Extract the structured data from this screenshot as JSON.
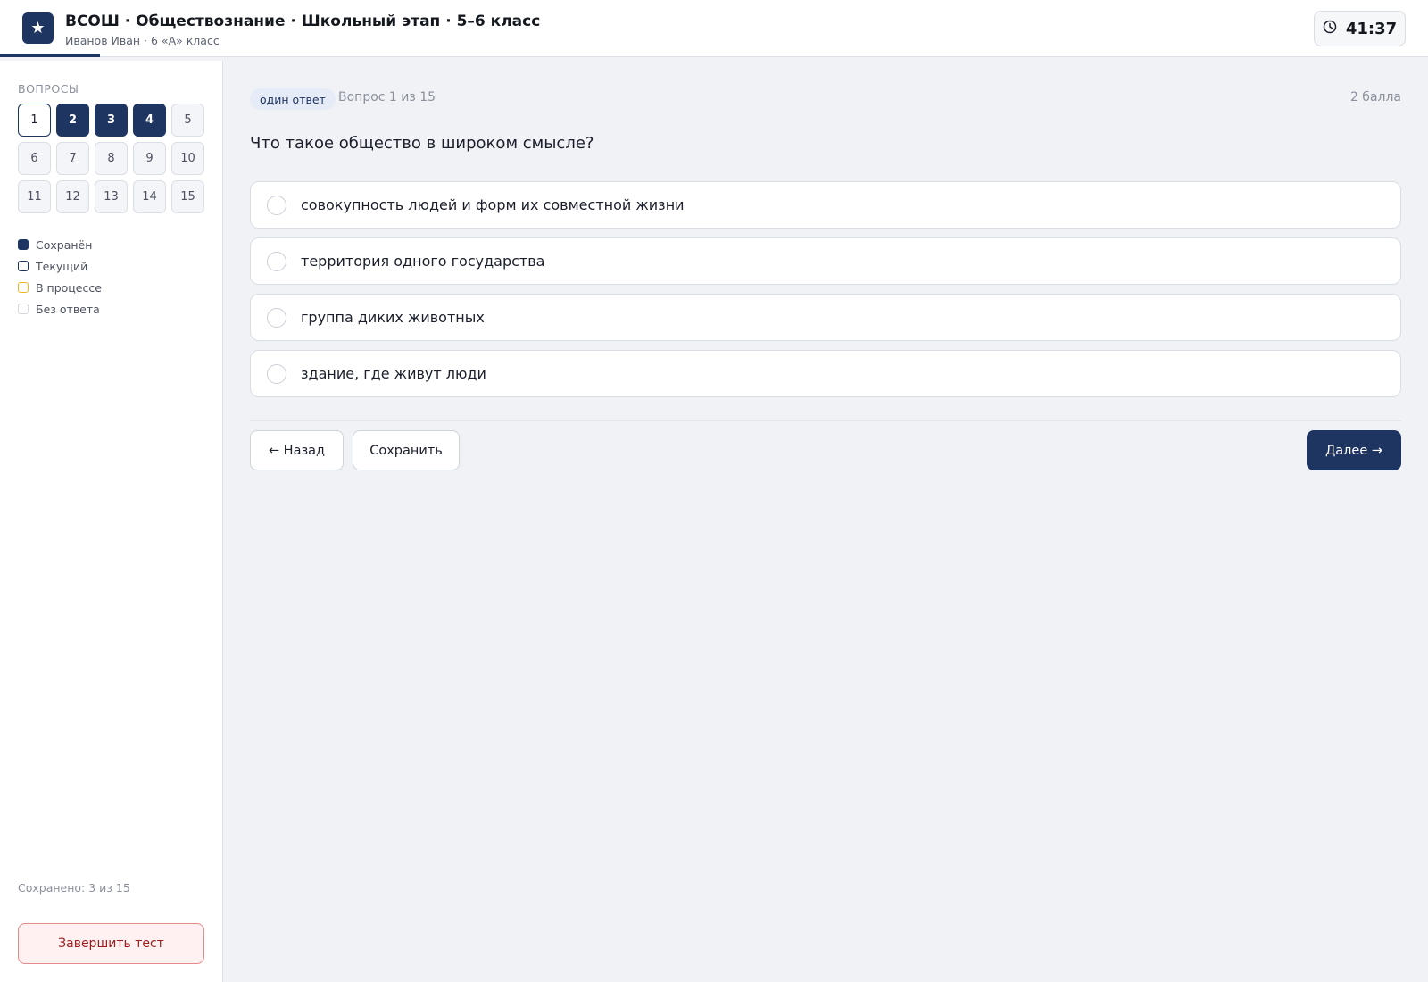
{
  "header": {
    "logo_glyph": "★",
    "title": "ВСОШ · Обществознание · Школьный этап · 5–6 класс",
    "subtitle": "Иванов Иван · 6 «А» класс",
    "timer": "41:37"
  },
  "sidebar": {
    "heading": "ВОПРОСЫ",
    "questions": [
      {
        "label": "1",
        "status": "current"
      },
      {
        "label": "2",
        "status": "saved"
      },
      {
        "label": "3",
        "status": "saved"
      },
      {
        "label": "4",
        "status": "saved"
      },
      {
        "label": "5",
        "status": "none"
      },
      {
        "label": "6",
        "status": "none"
      },
      {
        "label": "7",
        "status": "none"
      },
      {
        "label": "8",
        "status": "none"
      },
      {
        "label": "9",
        "status": "none"
      },
      {
        "label": "10",
        "status": "none"
      },
      {
        "label": "11",
        "status": "none"
      },
      {
        "label": "12",
        "status": "none"
      },
      {
        "label": "13",
        "status": "none"
      },
      {
        "label": "14",
        "status": "none"
      },
      {
        "label": "15",
        "status": "none"
      }
    ],
    "legend": {
      "saved": "Сохранён",
      "current": "Текущий",
      "in_progress": "В процессе",
      "no_answer": "Без ответа"
    },
    "saved_count": "Сохранено: 3 из 15",
    "finish_label": "Завершить тест"
  },
  "main": {
    "type_badge": "один ответ",
    "counter": "Вопрос 1 из 15",
    "points": "2 балла",
    "question": "Что такое общество в широком смысле?",
    "options": [
      "совокупность людей и форм их совместной жизни",
      "территория одного государства",
      "группа диких животных",
      "здание, где живут люди"
    ],
    "back_label": "← Назад",
    "save_label": "Сохранить",
    "next_label": "Далее →"
  },
  "colors": {
    "accent": "#1e3461",
    "in_progress": "#f0b429",
    "danger": "#9b1c1c"
  }
}
